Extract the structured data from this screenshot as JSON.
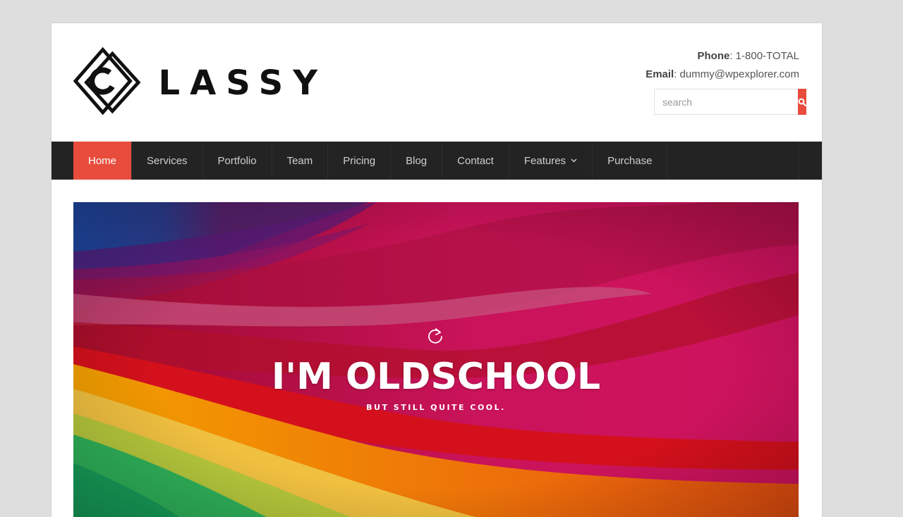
{
  "logo": {
    "text": "LASSY",
    "alt_letter": "C"
  },
  "contact": {
    "phone_label": "Phone",
    "phone_value": ": 1-800-TOTAL",
    "email_label": "Email",
    "email_value": ": dummy@wpexplorer.com"
  },
  "search": {
    "placeholder": "search",
    "icon": "search-icon"
  },
  "nav": {
    "items": [
      {
        "label": "Home",
        "active": true
      },
      {
        "label": "Services"
      },
      {
        "label": "Portfolio"
      },
      {
        "label": "Team"
      },
      {
        "label": "Pricing"
      },
      {
        "label": "Blog"
      },
      {
        "label": "Contact"
      },
      {
        "label": "Features",
        "has_dropdown": true
      },
      {
        "label": "Purchase"
      }
    ]
  },
  "hero": {
    "icon": "reload-icon",
    "title": "I'M OLDSCHOOL",
    "subtitle": "BUT STILL QUITE COOL."
  },
  "colors": {
    "accent": "#e74c3c",
    "nav_bg": "#232323",
    "page_bg": "#dedede"
  }
}
